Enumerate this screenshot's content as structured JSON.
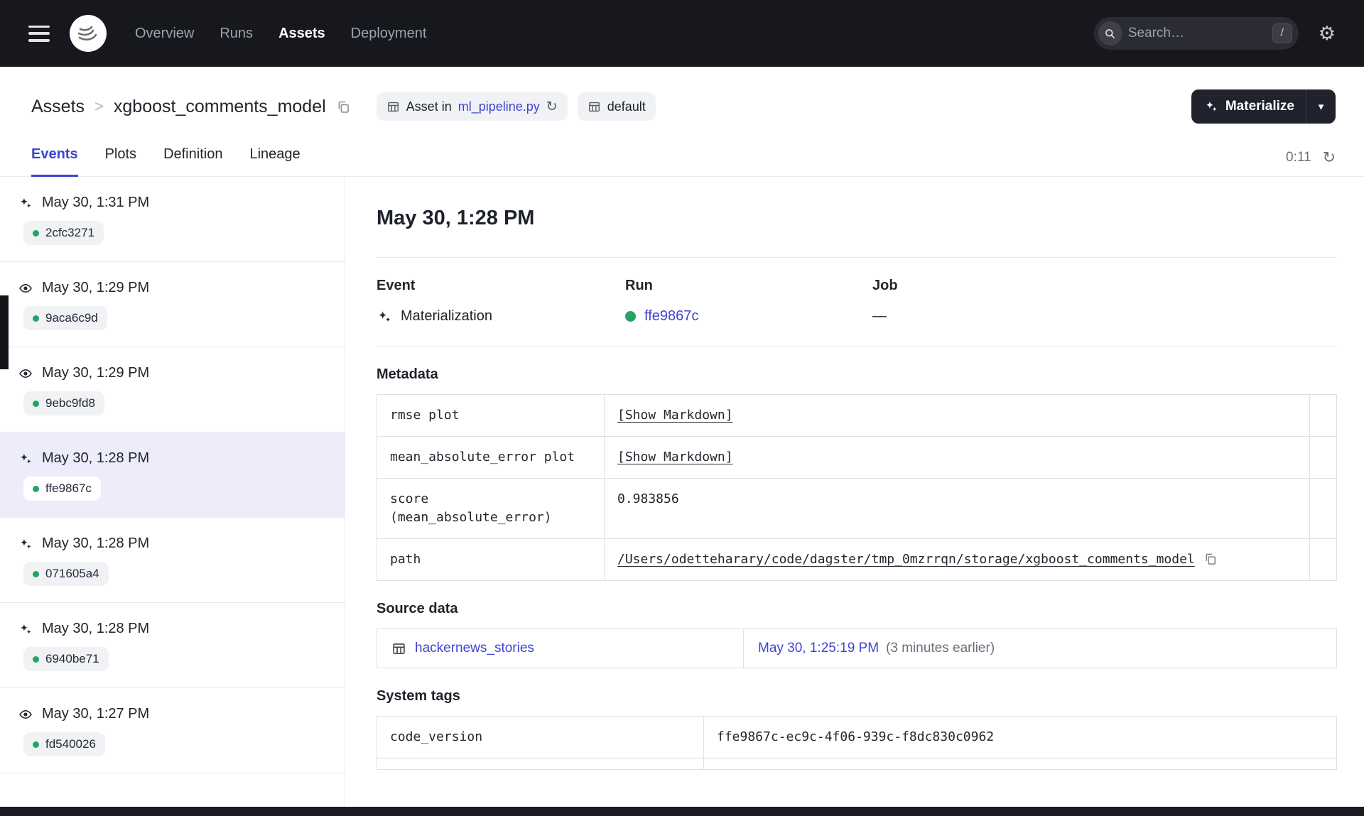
{
  "colors": {
    "accent": "#3E44CF",
    "success_green": "#23A466",
    "topnav_bg": "#17181D",
    "selected_row_bg": "#EDECFA"
  },
  "topnav": {
    "items": [
      {
        "label": "Overview"
      },
      {
        "label": "Runs"
      },
      {
        "label": "Assets"
      },
      {
        "label": "Deployment"
      }
    ],
    "search_placeholder": "Search…",
    "search_shortcut": "/"
  },
  "breadcrumb": {
    "root": "Assets",
    "separator": ">",
    "current": "xgboost_comments_model"
  },
  "header_badges": {
    "asset_in_prefix": "Asset in",
    "asset_file": "ml_pipeline.py",
    "group": "default"
  },
  "materialize": {
    "label": "Materialize"
  },
  "tabs": {
    "items": [
      {
        "label": "Events"
      },
      {
        "label": "Plots"
      },
      {
        "label": "Definition"
      },
      {
        "label": "Lineage"
      }
    ],
    "timer": "0:11"
  },
  "events_list": [
    {
      "type": "materialization",
      "time": "May 30, 1:31 PM",
      "run_id": "2cfc3271",
      "selected": false
    },
    {
      "type": "observation",
      "time": "May 30, 1:29 PM",
      "run_id": "9aca6c9d",
      "selected": false
    },
    {
      "type": "observation",
      "time": "May 30, 1:29 PM",
      "run_id": "9ebc9fd8",
      "selected": false
    },
    {
      "type": "materialization",
      "time": "May 30, 1:28 PM",
      "run_id": "ffe9867c",
      "selected": true
    },
    {
      "type": "materialization",
      "time": "May 30, 1:28 PM",
      "run_id": "071605a4",
      "selected": false
    },
    {
      "type": "materialization",
      "time": "May 30, 1:28 PM",
      "run_id": "6940be71",
      "selected": false
    },
    {
      "type": "observation",
      "time": "May 30, 1:27 PM",
      "run_id": "fd540026",
      "selected": false
    }
  ],
  "detail": {
    "title": "May 30, 1:28 PM",
    "event_label": "Event",
    "event_value": "Materialization",
    "run_label": "Run",
    "run_value": "ffe9867c",
    "job_label": "Job",
    "job_value": "—",
    "metadata": {
      "heading": "Metadata",
      "rows": [
        {
          "key": "rmse plot",
          "value": "[Show Markdown]"
        },
        {
          "key": "mean_absolute_error plot",
          "value": "[Show Markdown]"
        },
        {
          "key": "score (mean_absolute_error)",
          "value": "0.983856"
        },
        {
          "key": "path",
          "value": "/Users/odetteharary/code/dagster/tmp_0mzrrqn/storage/xgboost_comments_model"
        }
      ]
    },
    "source_data": {
      "heading": "Source data",
      "asset": "hackernews_stories",
      "time": "May 30, 1:25:19 PM",
      "time_note": "(3 minutes earlier)"
    },
    "system_tags": {
      "heading": "System tags",
      "rows": [
        {
          "key": "code_version",
          "value": "ffe9867c-ec9c-4f06-939c-f8dc830c0962"
        }
      ]
    }
  }
}
